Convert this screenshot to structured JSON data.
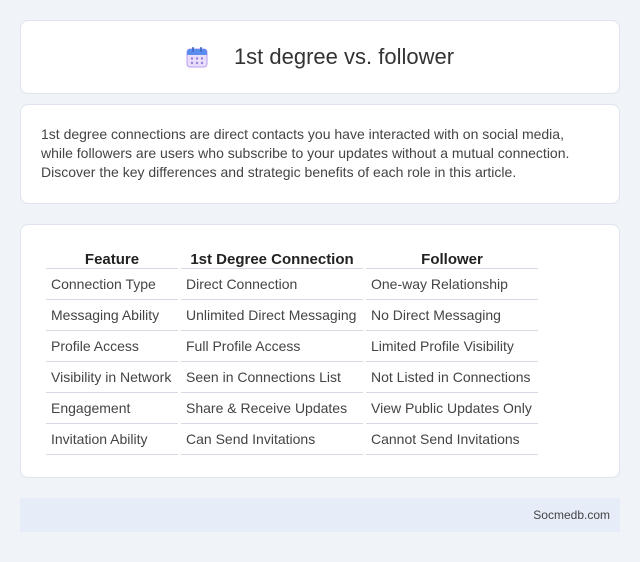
{
  "header": {
    "title": "1st degree vs. follower",
    "icon": "calendar-icon"
  },
  "description": "1st degree connections are direct contacts you have interacted with on social media, while followers are users who subscribe to your updates without a mutual connection. Discover the key differences and strategic benefits of each role in this article.",
  "table": {
    "columns": [
      "Feature",
      "1st Degree Connection",
      "Follower"
    ],
    "rows": [
      [
        "Connection Type",
        "Direct Connection",
        "One-way Relationship"
      ],
      [
        "Messaging Ability",
        "Unlimited Direct Messaging",
        "No Direct Messaging"
      ],
      [
        "Profile Access",
        "Full Profile Access",
        "Limited Profile Visibility"
      ],
      [
        "Visibility in Network",
        "Seen in Connections List",
        "Not Listed in Connections"
      ],
      [
        "Engagement",
        "Share & Receive Updates",
        "View Public Updates Only"
      ],
      [
        "Invitation Ability",
        "Can Send Invitations",
        "Cannot Send Invitations"
      ]
    ]
  },
  "footer": {
    "site": "Socmedb.com"
  }
}
